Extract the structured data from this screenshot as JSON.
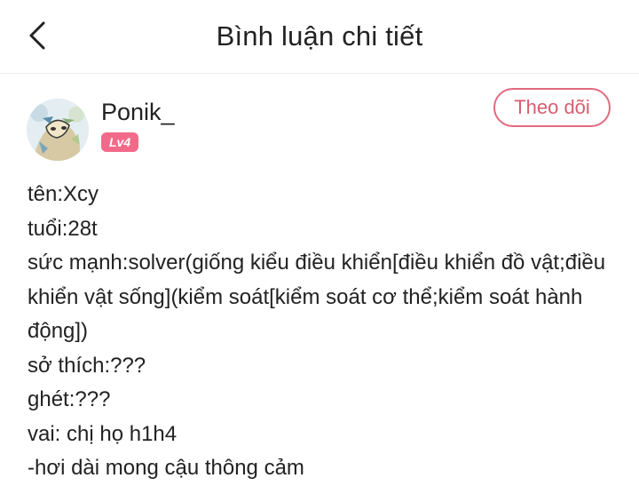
{
  "header": {
    "title": "Bình luận chi tiết",
    "back_icon": "chevron-left-icon"
  },
  "author": {
    "name": "Ponik_",
    "level": "Lv4",
    "follow_label": "Theo dõi",
    "accent_color": "#e26a7f"
  },
  "comment": {
    "lines": [
      "tên:Xcy",
      "tuổi:28t",
      "sức mạnh:solver(giống kiểu điều khiển[điều khiển đồ vật;điều khiển vật sống](kiểm soát[kiểm soát cơ thể;kiểm soát hành động])",
      "sở thích:???",
      "ghét:???",
      "vai: chị họ h1h4",
      "-hơi dài mong cậu thông cảm"
    ]
  }
}
